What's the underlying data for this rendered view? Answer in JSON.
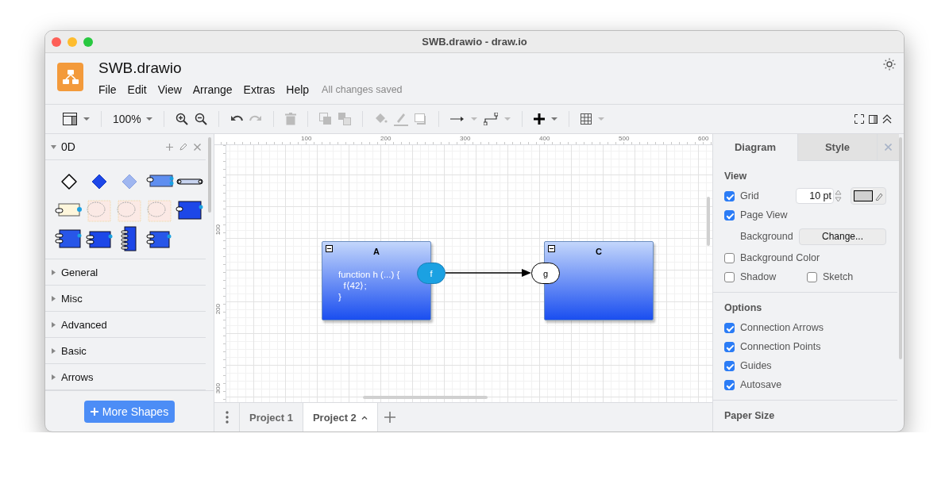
{
  "window": {
    "title": "SWB.drawio - draw.io"
  },
  "header": {
    "file_name": "SWB.drawio",
    "menu": [
      "File",
      "Edit",
      "View",
      "Arrange",
      "Extras",
      "Help"
    ],
    "save_status": "All changes saved"
  },
  "toolbar": {
    "zoom": "100%"
  },
  "sidebar": {
    "sections": [
      {
        "title": "0D",
        "expanded": true
      },
      {
        "title": "General",
        "expanded": false
      },
      {
        "title": "Misc",
        "expanded": false
      },
      {
        "title": "Advanced",
        "expanded": false
      },
      {
        "title": "Basic",
        "expanded": false
      },
      {
        "title": "Arrows",
        "expanded": false
      }
    ],
    "more_shapes": "More Shapes"
  },
  "canvas": {
    "top_ruler": [
      "100",
      "200",
      "300",
      "400",
      "500",
      "600"
    ],
    "left_ruler": [
      "100",
      "200",
      "300"
    ],
    "nodes": [
      {
        "title": "A",
        "body": "function h (...) {\n  f⟨42⟩;\n}",
        "port": {
          "label": "f",
          "kind": "out"
        }
      },
      {
        "title": "C",
        "port": {
          "label": "g",
          "kind": "in"
        }
      }
    ]
  },
  "page_tabs": [
    {
      "label": "Project 1",
      "selected": false
    },
    {
      "label": "Project 2",
      "selected": true
    }
  ],
  "format_panel": {
    "tabs": [
      {
        "label": "Diagram",
        "selected": true
      },
      {
        "label": "Style",
        "selected": false
      }
    ],
    "view": {
      "heading": "View",
      "grid": {
        "label": "Grid",
        "checked": true,
        "value": "10 pt"
      },
      "page_view": {
        "label": "Page View",
        "checked": true
      },
      "background": {
        "label": "Background",
        "button": "Change..."
      },
      "background_color": {
        "label": "Background Color",
        "checked": false
      },
      "shadow": {
        "label": "Shadow",
        "checked": false
      },
      "sketch": {
        "label": "Sketch",
        "checked": false
      }
    },
    "options": {
      "heading": "Options",
      "items": [
        {
          "label": "Connection Arrows",
          "checked": true
        },
        {
          "label": "Connection Points",
          "checked": true
        },
        {
          "label": "Guides",
          "checked": true
        },
        {
          "label": "Autosave",
          "checked": true
        }
      ]
    },
    "paper_size": {
      "heading": "Paper Size"
    }
  }
}
